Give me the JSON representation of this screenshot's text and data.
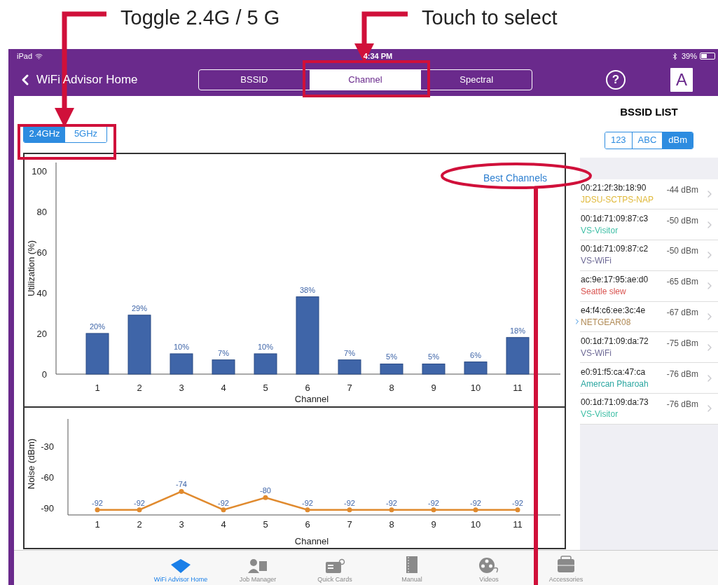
{
  "annotations": [
    {
      "kind": "left",
      "text": "Toggle 2.4G / 5 G"
    },
    {
      "kind": "right",
      "text": "Touch to select"
    }
  ],
  "status_bar": {
    "device": "iPad",
    "time": "4:34 PM",
    "battery": "39%"
  },
  "nav": {
    "back": "WiFi Advisor Home",
    "tabs": [
      {
        "label": "BSSID",
        "selected": false
      },
      {
        "label": "Channel",
        "selected": true
      },
      {
        "label": "Spectral",
        "selected": false
      }
    ],
    "help": "?",
    "logo": "A"
  },
  "band_toggle": [
    {
      "label": "2.4GHz",
      "selected": true
    },
    {
      "label": "5GHz",
      "selected": false
    }
  ],
  "best_channels": "Best Channels",
  "utilization_chart": {
    "chart_data": {
      "type": "bar",
      "xlabel": "Channel",
      "ylabel": "Utilization (%)",
      "categories": [
        "1",
        "2",
        "3",
        "4",
        "5",
        "6",
        "7",
        "8",
        "9",
        "10",
        "11"
      ],
      "values": [
        20,
        29,
        10,
        7,
        10,
        38,
        7,
        5,
        5,
        6,
        18
      ],
      "value_labels": [
        "20%",
        "29%",
        "10%",
        "7%",
        "10%",
        "38%",
        "7%",
        "5%",
        "5%",
        "6%",
        "18%"
      ],
      "ylim": [
        0,
        104
      ],
      "yticks": [
        0,
        20,
        40,
        60,
        80,
        100
      ]
    }
  },
  "noise_chart": {
    "chart_data": {
      "type": "line",
      "xlabel": "Channel",
      "ylabel": "Noise (dBm)",
      "categories": [
        "1",
        "2",
        "3",
        "4",
        "5",
        "6",
        "7",
        "8",
        "9",
        "10",
        "11"
      ],
      "values": [
        -92,
        -92,
        -74,
        -92,
        -80,
        -92,
        -92,
        -92,
        -92,
        -92,
        -92
      ],
      "value_labels": [
        "-92",
        "-92",
        "-74",
        "-92",
        "-80",
        "-92",
        "-92",
        "-92",
        "-92",
        "-92",
        "-92"
      ],
      "ylim": [
        -97,
        -3
      ],
      "yticks": [
        -90,
        -60,
        -30
      ],
      "marker": true
    }
  },
  "sidebar": {
    "title": "BSSID LIST",
    "sort": [
      {
        "label": "123",
        "selected": false
      },
      {
        "label": "ABC",
        "selected": false
      },
      {
        "label": "dBm",
        "selected": true
      }
    ],
    "items": [
      {
        "bssid": "00:21:2f:3b:18:90",
        "ssid": "JDSU-SCTPS-NAP",
        "color": "#e0b93a",
        "signal": "-44 dBm"
      },
      {
        "bssid": "00:1d:71:09:87:c3",
        "ssid": "VS-Visitor",
        "color": "#3fbfa6",
        "signal": "-50 dBm"
      },
      {
        "bssid": "00:1d:71:09:87:c2",
        "ssid": "VS-WiFi",
        "color": "#6e6a96",
        "signal": "-50 dBm"
      },
      {
        "bssid": "ac:9e:17:95:ae:d0",
        "ssid": "Seattle slew",
        "color": "#d9534f",
        "signal": "-65 dBm"
      },
      {
        "bssid": "e4:f4:c6:ee:3c:4e",
        "ssid": "NETGEAR08",
        "color": "#b08a55",
        "signal": "-67 dBm"
      },
      {
        "bssid": "00:1d:71:09:da:72",
        "ssid": "VS-WiFi",
        "color": "#6e6a96",
        "signal": "-75 dBm"
      },
      {
        "bssid": "e0:91:f5:ca:47:ca",
        "ssid": "Amercan Pharoah",
        "color": "#2aa6a0",
        "signal": "-76 dBm"
      },
      {
        "bssid": "00:1d:71:09:da:73",
        "ssid": "VS-Visitor",
        "color": "#3fbfa6",
        "signal": "-76 dBm"
      }
    ]
  },
  "tab_bar": [
    {
      "kind": "home",
      "label": "WiFi Advisor Home",
      "selected": true
    },
    {
      "kind": "jobs",
      "label": "Job Manager",
      "selected": false
    },
    {
      "kind": "cards",
      "label": "Quick Cards",
      "selected": false
    },
    {
      "kind": "manual",
      "label": "Manual",
      "selected": false
    },
    {
      "kind": "videos",
      "label": "Videos",
      "selected": false
    },
    {
      "kind": "accessories",
      "label": "Accessories",
      "selected": false
    }
  ]
}
